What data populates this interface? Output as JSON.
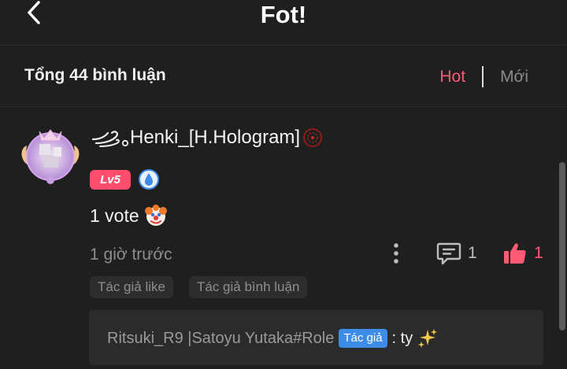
{
  "header": {
    "title": "Fot!"
  },
  "subheader": {
    "total_comments": "Tổng 44 bình luận",
    "sort_hot": "Hot",
    "sort_new": "Mới"
  },
  "comment": {
    "username": "Henki_[H.Hologram]",
    "level": "Lv5",
    "content": "1 vote",
    "time": "1 giờ trước",
    "reply_count": "1",
    "like_count": "1",
    "tags": [
      "Tác giả like",
      "Tác giả bình luận"
    ],
    "reply": {
      "author": "Ritsuki_R9 |Satoyu Yutaka#Role",
      "author_tag": "Tác giả",
      "text": ": ty"
    }
  },
  "colors": {
    "accent": "#ff5a74",
    "author_tag": "#3d8de8",
    "background": "#1f1f1f"
  }
}
